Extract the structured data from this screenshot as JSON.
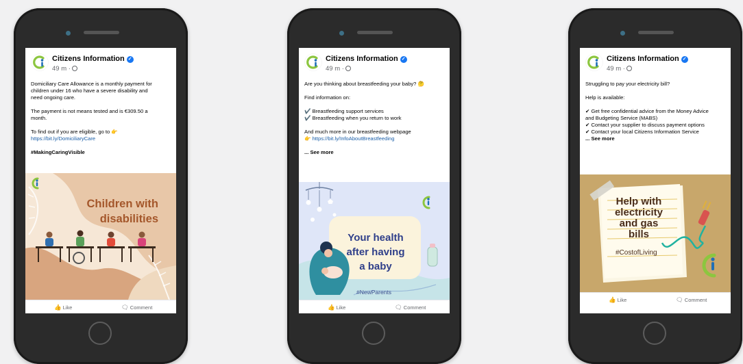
{
  "posts": [
    {
      "page_name": "Citizens Information",
      "time": "49 m ·",
      "text": [
        "Domiciliary Care Allowance is a monthly payment for children under 16 who have a severe disability and need ongoing care.",
        "The payment is not means tested and is €309.50 a month.",
        "To find out if you are eligible, go to 👉"
      ],
      "link": "https://bit.ly/DomiciliaryCare",
      "hashtag": "#MakingCaringVisible",
      "image_title": [
        "Children with",
        "disabilities"
      ],
      "like_label": "Like",
      "comment_label": "Comment"
    },
    {
      "page_name": "Citizens Information",
      "time": "49 m ·",
      "intro": "Are you thinking about breastfeeding your baby? 🤔",
      "find_label": "Find information on:",
      "checklist": [
        "Breastfeeding support services",
        "Breastfeeding when you return to work"
      ],
      "more": "And much more in our breastfeeding webpage",
      "link": "https://bit.ly/InfoAboutBreastfeeding",
      "see_more": "... See more",
      "image_title": [
        "Your health",
        "after having",
        "a baby"
      ],
      "image_hashtag": "#NewParents",
      "like_label": "Like",
      "comment_label": "Comment"
    },
    {
      "page_name": "Citizens Information",
      "time": "49 m ·",
      "intro": "Struggling to pay your electricity bill?",
      "help_label": "Help is available:",
      "checklist": [
        "Get free confidential advice from the Money Advice and Budgeting Service (MABS)",
        "Contact your supplier to discuss payment options",
        "Contact your local Citizens Information Service"
      ],
      "see_more": "... See more",
      "image_title": [
        "Help with",
        "electricity",
        "and gas",
        "bills"
      ],
      "image_hashtag": "#CostofLiving",
      "like_label": "Like",
      "comment_label": "Comment"
    }
  ],
  "colors": {
    "brand_green": "#8cc63f",
    "brand_blue": "#1f6fb7",
    "fb_blue": "#1877f2"
  }
}
